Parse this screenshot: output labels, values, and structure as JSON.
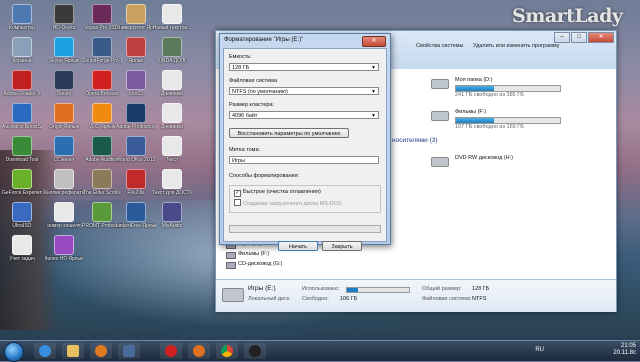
{
  "logo": {
    "text": "SmartLady"
  },
  "desktop": {
    "icons": [
      {
        "label": "Компьютер",
        "color": "#4d78b0"
      },
      {
        "label": "HD-Decks",
        "color": "#3a3a3a"
      },
      {
        "label": "Vegas Pro 2013",
        "color": "#6a2a5a"
      },
      {
        "label": "Университет Ярлык",
        "color": "#c8a060"
      },
      {
        "label": "Новый текстов...",
        "color": "#e8e8e8"
      },
      {
        "label": "Корзина",
        "color": "#8aa0b8"
      },
      {
        "label": "Skype Ярлык",
        "color": "#1aa0e0"
      },
      {
        "label": "SoundForge Pro 10.0",
        "color": "#3a5a8a"
      },
      {
        "label": "Ярлык",
        "color": "#c04040"
      },
      {
        "label": "KINDA ДОЛГ",
        "color": "#5a7a5a"
      },
      {
        "label": "Adobe Reader X",
        "color": "#c02020"
      },
      {
        "label": "Steam",
        "color": "#2a3a5a"
      },
      {
        "label": "Opera Browser",
        "color": "#d02020"
      },
      {
        "label": "foto62",
        "color": "#7a5aa0"
      },
      {
        "label": "Дневники",
        "color": "#e8e8e8"
      },
      {
        "label": "Auslogics BoostSpeed",
        "color": "#2a6ac0"
      },
      {
        "label": "Origin Ярлык",
        "color": "#e07020"
      },
      {
        "label": "VLC Ярлык",
        "color": "#f08a10"
      },
      {
        "label": "Adobe Photoshop",
        "color": "#1a3a6a"
      },
      {
        "label": "Дневники",
        "color": "#e8e8e8"
      },
      {
        "label": "Download Tool",
        "color": "#3a8a3a"
      },
      {
        "label": "CCleaner",
        "color": "#2a70b0"
      },
      {
        "label": "Adobe Audition",
        "color": "#1a5a4a"
      },
      {
        "label": "World Ofice 2013",
        "color": "#3a5a9a"
      },
      {
        "label": "Текст",
        "color": "#e8e8e8"
      },
      {
        "label": "GeForce Experience",
        "color": "#6ab02a"
      },
      {
        "label": "Кнопки реферата",
        "color": "#c0c0c0"
      },
      {
        "label": "The Elder Scrolls",
        "color": "#8a7a5a"
      },
      {
        "label": "FileZilla",
        "color": "#c02a2a"
      },
      {
        "label": "Текст для ДОСТУПНОСТИ",
        "color": "#e8e8e8"
      },
      {
        "label": "UltraISO",
        "color": "#3a6ac0"
      },
      {
        "label": "номер кошеля",
        "color": "#e8e8e8"
      },
      {
        "label": "PROMT Professional",
        "color": "#5a9a3a"
      },
      {
        "label": "LinkedFree Ярлык",
        "color": "#2a5a9a"
      },
      {
        "label": "MixAudio",
        "color": "#4a4a8a"
      },
      {
        "label": "Учет задач",
        "color": "#e8e8e8"
      },
      {
        "label": "Itunes HD Ярлык",
        "color": "#9a4ac0"
      }
    ]
  },
  "explorer": {
    "command_bar": [
      "Свойства системы",
      "Удалить или изменить программу"
    ],
    "drives": [
      {
        "name": "Моя папка (D:)",
        "free": "241 ГБ свободно из 385 ГБ",
        "fill": 0.37
      },
      {
        "name": "Фильмы (F:)",
        "free": "107 ГБ свободно из 169 ГБ",
        "fill": 0.37
      }
    ],
    "section_label": "носителями (3)",
    "dvd_label": "DVD RW дисковод (H:)",
    "tree": [
      "Игры (E:)",
      "Фильмы (F:)",
      "CD-дисковод (G:)"
    ],
    "details": {
      "drive_name": "Игры (E:)",
      "drive_type": "Локальный диск",
      "used_label": "Использовано:",
      "free_label": "Свободно:",
      "free_value": "106 ГБ",
      "total_label": "Общий размер:",
      "total_value": "128 ГБ",
      "fs_label": "Файловая система:",
      "fs_value": "NTFS",
      "used_fraction": 0.17
    }
  },
  "dialog": {
    "title": "Форматирование \"Игры (E:)\"",
    "close": "✕",
    "capacity_label": "Емкость:",
    "capacity_value": "128 ГБ",
    "fs_label": "Файловая система",
    "fs_value": "NTFS (по умолчанию)",
    "cluster_label": "Размер кластера:",
    "cluster_value": "4096 байт",
    "restore_defaults": "Восстановить параметры по умолчанию",
    "volume_label_label": "Метка тома:",
    "volume_label_value": "Игры",
    "format_options_label": "Способы форматирования:",
    "quick_format": "Быстрое (очистка оглавления)",
    "msdos_disk": "Создание загрузочного диска MS-DOS",
    "start_button": "Начать",
    "close_button": "Закрыть",
    "progress": 0
  },
  "taskbar": {
    "lang": "RU",
    "time": "21:05",
    "date": "20.11.8с"
  }
}
